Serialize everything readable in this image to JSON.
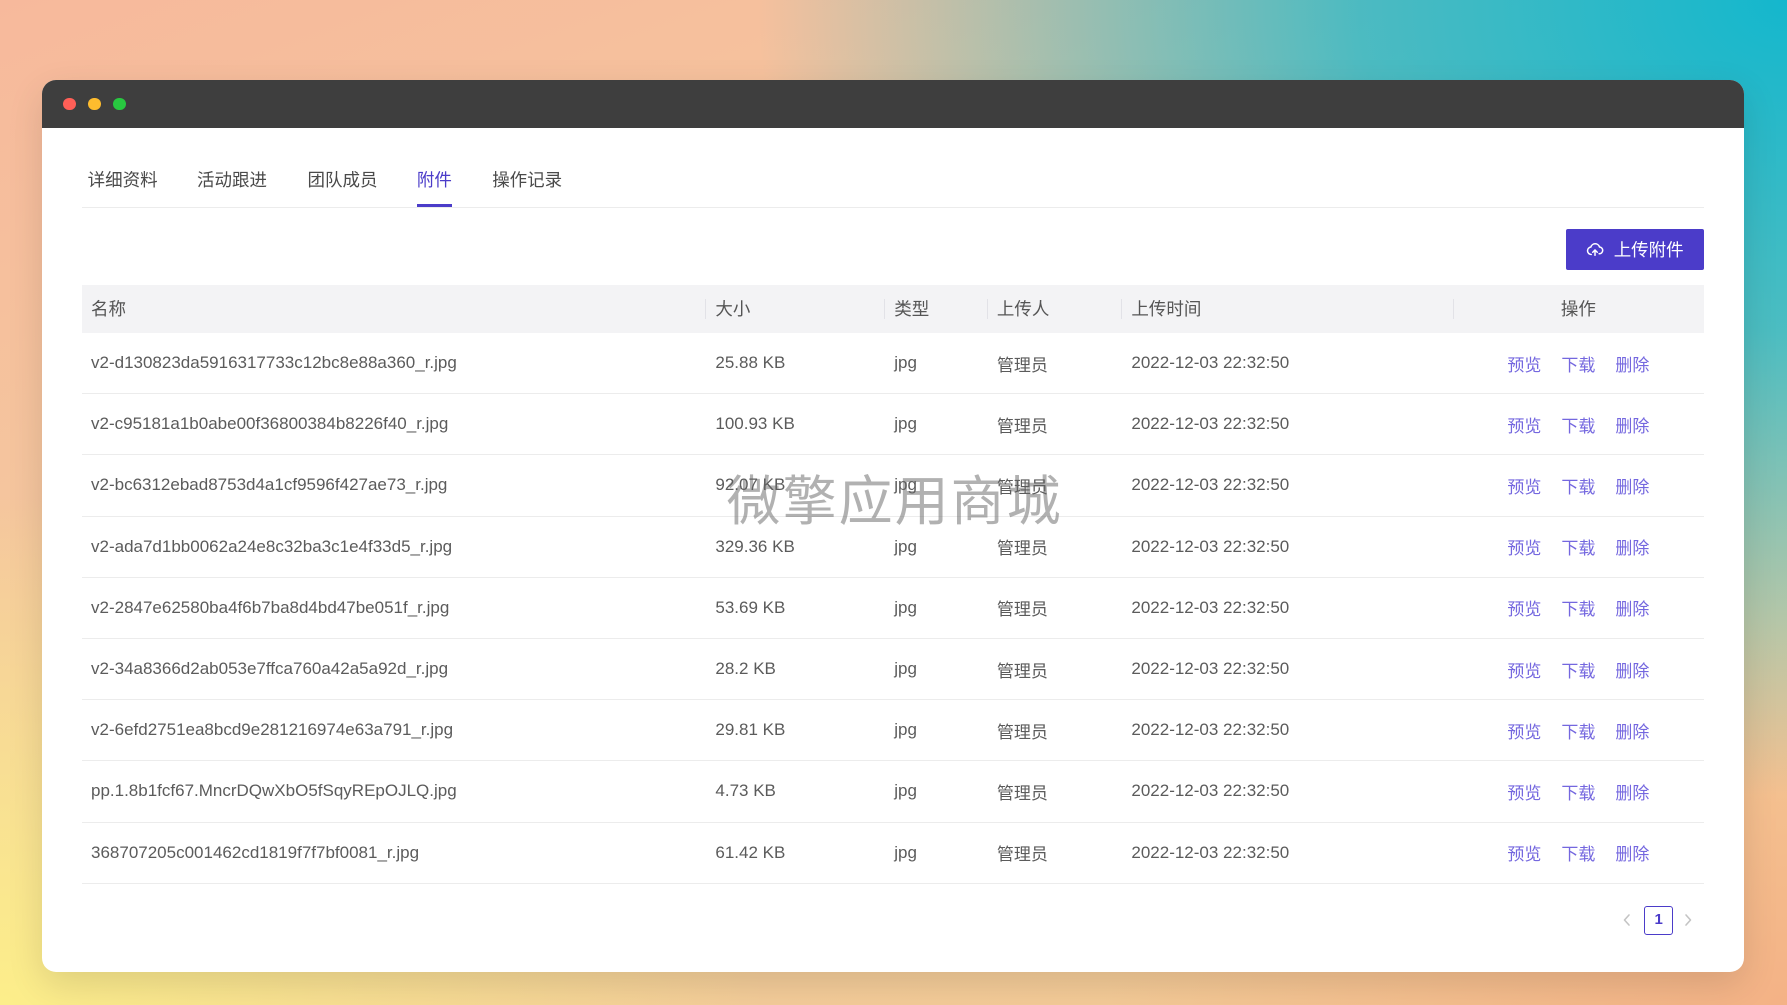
{
  "window": {
    "control_colors": [
      "#ff5f57",
      "#febc2e",
      "#28c840"
    ]
  },
  "tabs": [
    {
      "label": "详细资料",
      "active": false
    },
    {
      "label": "活动跟进",
      "active": false
    },
    {
      "label": "团队成员",
      "active": false
    },
    {
      "label": "附件",
      "active": true
    },
    {
      "label": "操作记录",
      "active": false
    }
  ],
  "toolbar": {
    "upload_label": "上传附件",
    "upload_icon": "cloud-upload-icon"
  },
  "table": {
    "columns": {
      "name": "名称",
      "size": "大小",
      "type": "类型",
      "uploader": "上传人",
      "time": "上传时间",
      "actions": "操作"
    },
    "rows": [
      {
        "name": "v2-d130823da5916317733c12bc8e88a360_r.jpg",
        "size": "25.88 KB",
        "type": "jpg",
        "uploader": "管理员",
        "time": "2022-12-03 22:32:50"
      },
      {
        "name": "v2-c95181a1b0abe00f36800384b8226f40_r.jpg",
        "size": "100.93 KB",
        "type": "jpg",
        "uploader": "管理员",
        "time": "2022-12-03 22:32:50"
      },
      {
        "name": "v2-bc6312ebad8753d4a1cf9596f427ae73_r.jpg",
        "size": "92.07 KB",
        "type": "jpg",
        "uploader": "管理员",
        "time": "2022-12-03 22:32:50"
      },
      {
        "name": "v2-ada7d1bb0062a24e8c32ba3c1e4f33d5_r.jpg",
        "size": "329.36 KB",
        "type": "jpg",
        "uploader": "管理员",
        "time": "2022-12-03 22:32:50"
      },
      {
        "name": "v2-2847e62580ba4f6b7ba8d4bd47be051f_r.jpg",
        "size": "53.69 KB",
        "type": "jpg",
        "uploader": "管理员",
        "time": "2022-12-03 22:32:50"
      },
      {
        "name": "v2-34a8366d2ab053e7ffca760a42a5a92d_r.jpg",
        "size": "28.2 KB",
        "type": "jpg",
        "uploader": "管理员",
        "time": "2022-12-03 22:32:50"
      },
      {
        "name": "v2-6efd2751ea8bcd9e281216974e63a791_r.jpg",
        "size": "29.81 KB",
        "type": "jpg",
        "uploader": "管理员",
        "time": "2022-12-03 22:32:50"
      },
      {
        "name": "pp.1.8b1fcf67.MncrDQwXbO5fSqyREpOJLQ.jpg",
        "size": "4.73 KB",
        "type": "jpg",
        "uploader": "管理员",
        "time": "2022-12-03 22:32:50"
      },
      {
        "name": "368707205c001462cd1819f7f7bf0081_r.jpg",
        "size": "61.42 KB",
        "type": "jpg",
        "uploader": "管理员",
        "time": "2022-12-03 22:32:50"
      }
    ],
    "actions": [
      "预览",
      "下载",
      "删除"
    ]
  },
  "pagination": {
    "current": "1",
    "prev_icon": "chevron-left-icon",
    "next_icon": "chevron-right-icon"
  },
  "watermark": "微擎应用商城",
  "colors": {
    "accent": "#4b3cc9",
    "link": "#7467df",
    "titlebar": "#3e3e3e",
    "header_bg": "#f3f3f5"
  }
}
